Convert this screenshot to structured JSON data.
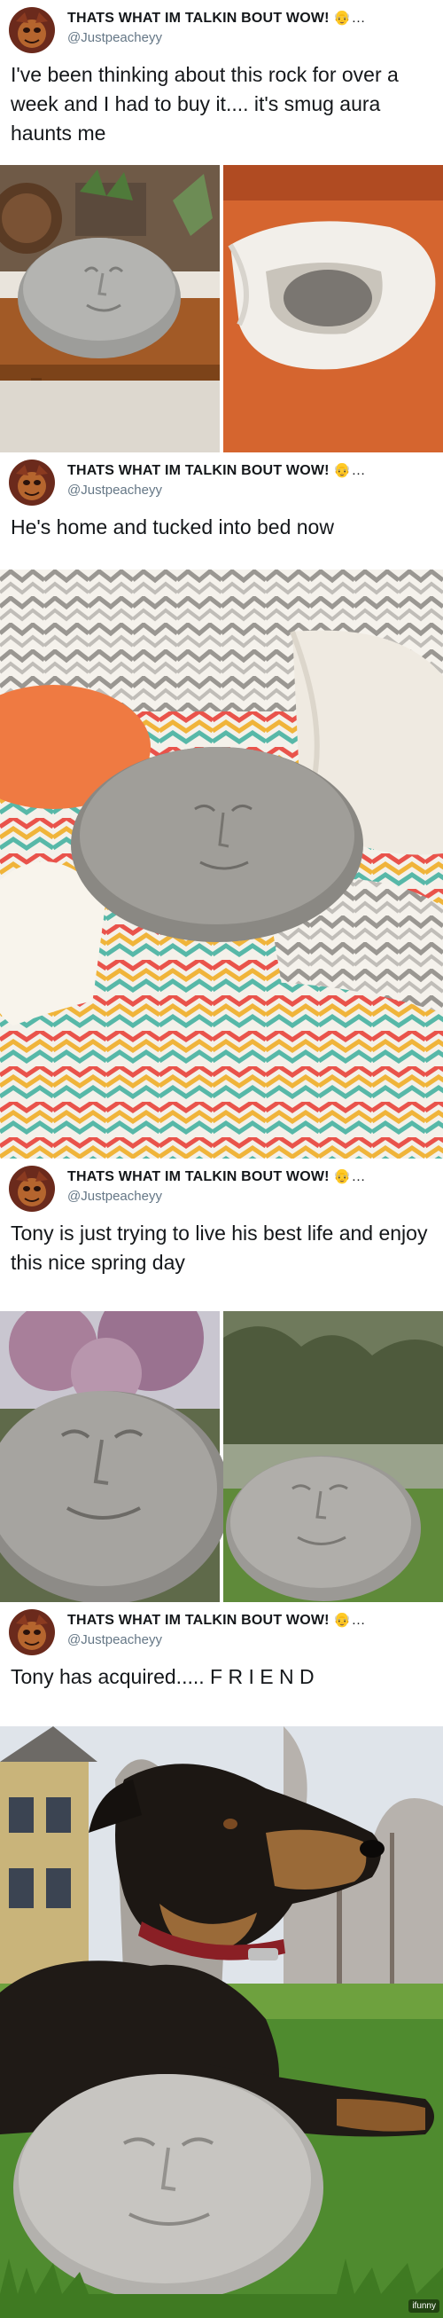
{
  "account": {
    "display_name": "THATS WHAT IM TALKIN BOUT WOW!",
    "name_emoji": "👴…",
    "handle": "@Justpeacheyy"
  },
  "tweets": [
    {
      "text": "I've been thinking about this rock for over a week and I had to buy it.... it's smug aura haunts me"
    },
    {
      "text": "He's home and tucked into bed now"
    },
    {
      "text": "Tony is just trying to live his best life and enjoy this nice spring day"
    },
    {
      "text": "Tony has acquired..... F R I E N D"
    }
  ],
  "watermark": "ifunny"
}
